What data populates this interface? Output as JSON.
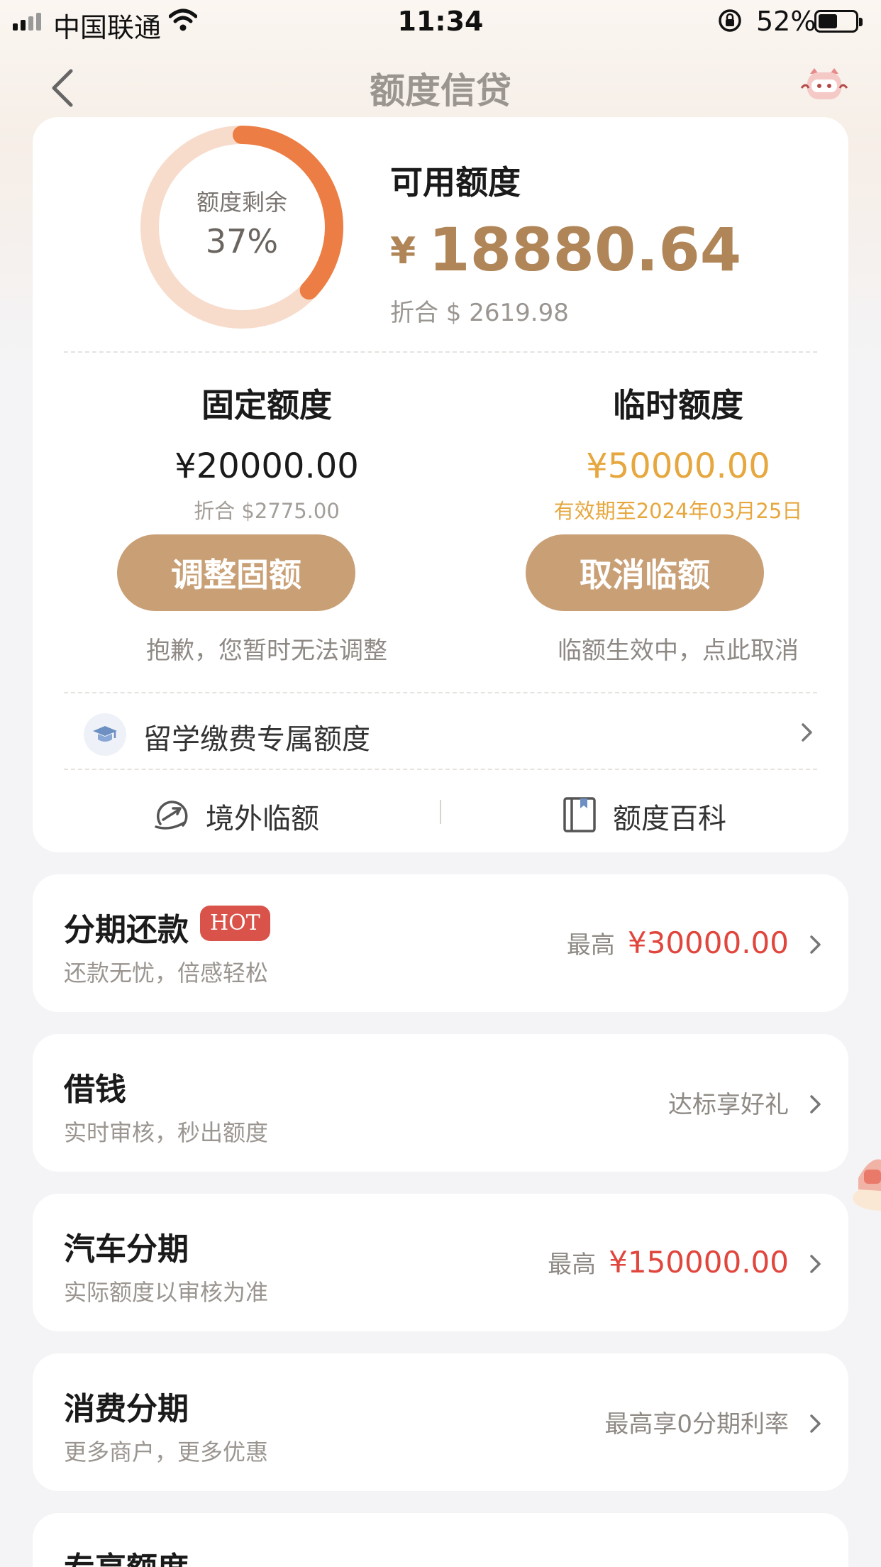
{
  "status_bar": {
    "carrier": "中国联通",
    "time": "11:34",
    "battery": "52%"
  },
  "nav": {
    "title": "额度信贷"
  },
  "quota": {
    "donut_label": "额度剩余",
    "donut_percent": "37%",
    "remaining_fraction": 0.37,
    "available_title": "可用额度",
    "currency_symbol": "¥",
    "available_amount": "18880.64",
    "available_usd": "折合 $ 2619.98",
    "fixed": {
      "title": "固定额度",
      "amount": "¥20000.00",
      "usd": "折合 $2775.00",
      "button": "调整固额",
      "note": "抱歉，您暂时无法调整"
    },
    "temporary": {
      "title": "临时额度",
      "amount": "¥50000.00",
      "validity": "有效期至2024年03月25日",
      "button": "取消临额",
      "note": "临额生效中，点此取消"
    },
    "study_row_label": "留学缴费专属额度",
    "tools": {
      "overseas": "境外临额",
      "encyclopedia": "额度百科"
    }
  },
  "products": [
    {
      "title": "分期还款",
      "badge": "HOT",
      "subtitle": "还款无忧，倍感轻松",
      "right_label": "最高",
      "right_value": "¥30000.00"
    },
    {
      "title": "借钱",
      "subtitle": "实时审核，秒出额度",
      "right_label": "达标享好礼"
    },
    {
      "title": "汽车分期",
      "subtitle": "实际额度以审核为准",
      "right_label": "最高",
      "right_value": "¥150000.00"
    },
    {
      "title": "消费分期",
      "subtitle": "更多商户，更多优惠",
      "right_label": "最高享0分期利率"
    },
    {
      "title": "专享额度"
    }
  ],
  "colors": {
    "accent_gold": "#c9a076",
    "amount_brown": "#b08558",
    "temp_orange": "#e6a73e",
    "donut_fill": "#ec7d44",
    "donut_track": "#f7dccc",
    "red_value": "#e0463d",
    "hot_badge": "#d9534a"
  }
}
